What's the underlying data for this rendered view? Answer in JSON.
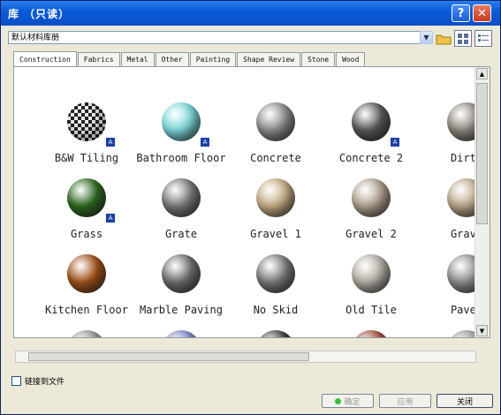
{
  "window": {
    "title": "库 （只读）"
  },
  "path_field": {
    "value": "默认材料库册"
  },
  "tabs": [
    "Construction",
    "Fabrics",
    "Metal",
    "Other",
    "Painting",
    "Shape Review",
    "Stone",
    "Wood"
  ],
  "materials": [
    {
      "name": "B&W Tiling",
      "color": "checker",
      "badge": true
    },
    {
      "name": "Bathroom Floor",
      "color": "#7fd9dc",
      "badge": true
    },
    {
      "name": "Concrete",
      "color": "#8d8d8d",
      "badge": false
    },
    {
      "name": "Concrete 2",
      "color": "#5a5a5a",
      "badge": true
    },
    {
      "name": "Dirty",
      "color": "#8f8a80",
      "badge": false
    },
    {
      "name": "Grass",
      "color": "#2f6a22",
      "badge": true
    },
    {
      "name": "Grate",
      "color": "#7a7a7a",
      "badge": false
    },
    {
      "name": "Gravel 1",
      "color": "#c6ad85",
      "badge": false
    },
    {
      "name": "Gravel 2",
      "color": "#b3a391",
      "badge": false
    },
    {
      "name": "Grave",
      "color": "#bba98a",
      "badge": false
    },
    {
      "name": "Kitchen Floor",
      "color": "#a3521a",
      "badge": false
    },
    {
      "name": "Marble Paving",
      "color": "#6f6f6f",
      "badge": false
    },
    {
      "name": "No Skid",
      "color": "#7b7b7b",
      "badge": false
    },
    {
      "name": "Old Tile",
      "color": "#b5b0a6",
      "badge": false
    },
    {
      "name": "Pavea",
      "color": "#8f8f8f",
      "badge": false
    },
    {
      "name": "",
      "color": "#9a9a9a",
      "badge": false
    },
    {
      "name": "",
      "color": "#7e86c9",
      "badge": false
    },
    {
      "name": "",
      "color": "#3e3e3e",
      "badge": false
    },
    {
      "name": "",
      "color": "#a14a3a",
      "badge": false
    },
    {
      "name": "",
      "color": "#9a9a9a",
      "badge": false
    }
  ],
  "checkbox": {
    "label": "链接到文件",
    "checked": false
  },
  "buttons": {
    "ok": "确定",
    "apply": "应用",
    "close": "关闭"
  }
}
